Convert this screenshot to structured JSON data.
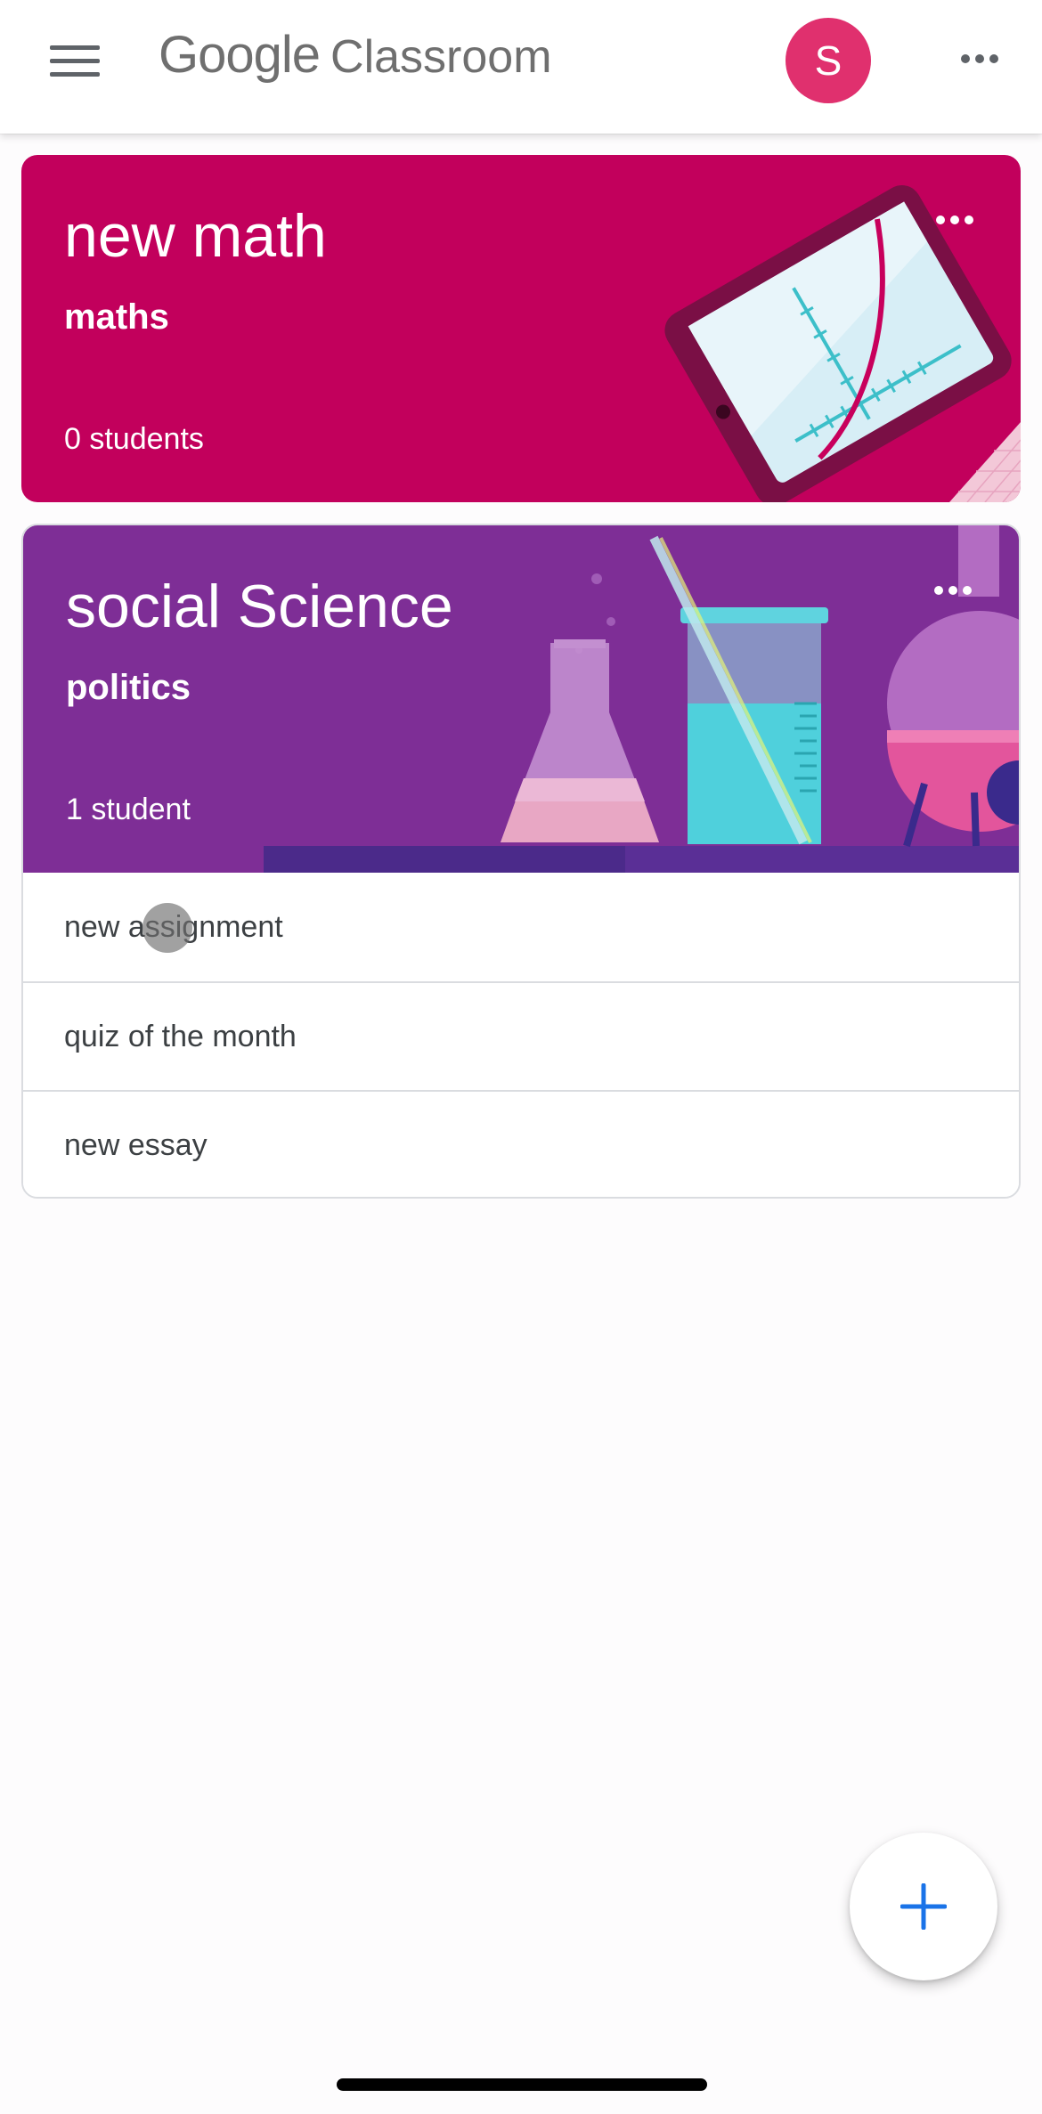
{
  "header": {
    "menu_icon": "hamburger-menu-icon",
    "brand_google": "Google",
    "brand_product": "Classroom",
    "avatar_initial": "S",
    "avatar_color": "#e0306e",
    "more_icon": "more-horizontal-icon"
  },
  "classes": [
    {
      "title": "new math",
      "section": "maths",
      "students": "0 students",
      "theme_color": "#c2005c",
      "illustration": "tablet-graph-illustration"
    },
    {
      "title": "social Science",
      "section": "politics",
      "students": "1 student",
      "theme_color": "#7e2e96",
      "illustration": "lab-flasks-illustration",
      "assignments": [
        "new assignment",
        "quiz of the month",
        "new essay"
      ]
    }
  ],
  "fab": {
    "icon": "plus-icon",
    "color": "#1a73e8"
  }
}
